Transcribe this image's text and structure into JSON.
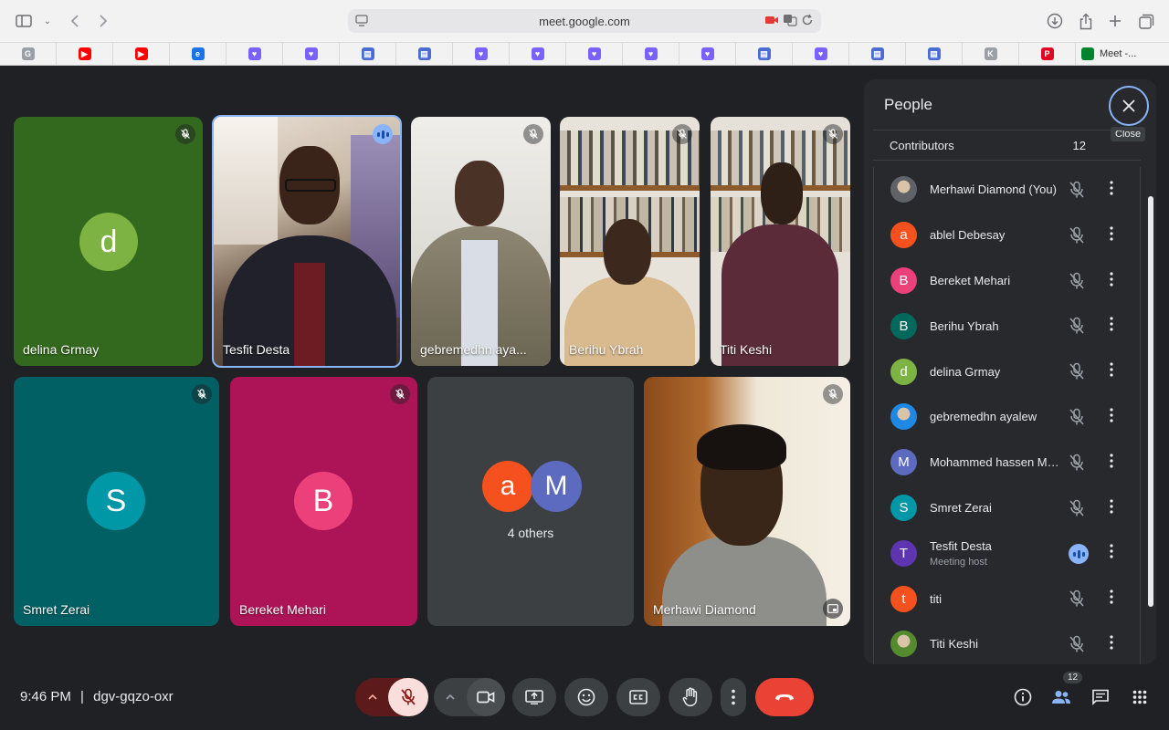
{
  "browser": {
    "url": "meet.google.com",
    "last_tab_label": "Meet -...",
    "bookmark_icons": [
      {
        "icon": "g-icon",
        "color": "#9aa0a6",
        "glyph": "G"
      },
      {
        "icon": "youtube-icon",
        "color": "#ff0000",
        "glyph": "▶"
      },
      {
        "icon": "youtube-icon",
        "color": "#ff0000",
        "glyph": "▶"
      },
      {
        "icon": "edge-icon",
        "color": "#1a73e8",
        "glyph": "e"
      },
      {
        "icon": "chat-icon",
        "color": "#7b61ff",
        "glyph": "♥"
      },
      {
        "icon": "chat-icon",
        "color": "#7b61ff",
        "glyph": "♥"
      },
      {
        "icon": "print-icon",
        "color": "#4a6cd4",
        "glyph": "▤"
      },
      {
        "icon": "print-icon",
        "color": "#4a6cd4",
        "glyph": "▤"
      },
      {
        "icon": "chat-icon",
        "color": "#7b61ff",
        "glyph": "♥"
      },
      {
        "icon": "chat-icon",
        "color": "#7b61ff",
        "glyph": "♥"
      },
      {
        "icon": "chat-icon",
        "color": "#7b61ff",
        "glyph": "♥"
      },
      {
        "icon": "chat-icon",
        "color": "#7b61ff",
        "glyph": "♥"
      },
      {
        "icon": "chat-icon",
        "color": "#7b61ff",
        "glyph": "♥"
      },
      {
        "icon": "print-icon",
        "color": "#4a6cd4",
        "glyph": "▤"
      },
      {
        "icon": "chat-icon",
        "color": "#7b61ff",
        "glyph": "♥"
      },
      {
        "icon": "print-icon",
        "color": "#4a6cd4",
        "glyph": "▤"
      },
      {
        "icon": "print-icon",
        "color": "#4a6cd4",
        "glyph": "▤"
      },
      {
        "icon": "k-icon",
        "color": "#9aa0a6",
        "glyph": "K"
      },
      {
        "icon": "pinterest-icon",
        "color": "#e60023",
        "glyph": "P"
      }
    ]
  },
  "tiles": [
    {
      "name": "delina Grmay",
      "type": "avatar",
      "letter": "d",
      "bg": "#33691e",
      "avatar": "#7cb342"
    },
    {
      "name": "Tesfit Desta",
      "type": "video",
      "speaking": true
    },
    {
      "name": "gebremedhn aya...",
      "type": "video"
    },
    {
      "name": "Berihu Ybrah",
      "type": "video"
    },
    {
      "name": "Titi Keshi",
      "type": "video"
    },
    {
      "name": "Smret Zerai",
      "type": "avatar",
      "letter": "S",
      "bg": "#006064",
      "avatar": "#0097a7"
    },
    {
      "name": "Bereket Mehari",
      "type": "avatar",
      "letter": "B",
      "bg": "#ad1457",
      "avatar": "#ec407a"
    },
    {
      "name": "4 others",
      "type": "others",
      "letters": [
        "a",
        "M"
      ]
    },
    {
      "name": "Merhawi Diamond",
      "type": "video"
    }
  ],
  "panel": {
    "title": "People",
    "close_tooltip": "Close",
    "section_label": "Contributors",
    "section_count": "12",
    "people": [
      {
        "name": "Merhawi Diamond (You)",
        "letter": "",
        "color": "#5f6368",
        "photo": true
      },
      {
        "name": "ablel Debesay",
        "letter": "a",
        "color": "#f4511e"
      },
      {
        "name": "Bereket Mehari",
        "letter": "B",
        "color": "#ec407a"
      },
      {
        "name": "Berihu Ybrah",
        "letter": "B",
        "color": "#00695c"
      },
      {
        "name": "delina Grmay",
        "letter": "d",
        "color": "#7cb342"
      },
      {
        "name": "gebremedhn ayalew",
        "letter": "",
        "color": "#1e88e5",
        "photo": true
      },
      {
        "name": "Mohammed hassen Mo...",
        "letter": "M",
        "color": "#5c6bc0"
      },
      {
        "name": "Smret Zerai",
        "letter": "S",
        "color": "#0097a7"
      },
      {
        "name": "Tesfit Desta",
        "sub": "Meeting host",
        "letter": "T",
        "color": "#5e35b1",
        "speaking": true
      },
      {
        "name": "titi",
        "letter": "t",
        "color": "#f4511e"
      },
      {
        "name": "Titi Keshi",
        "letter": "",
        "color": "#558b2f",
        "photo": true
      }
    ]
  },
  "bottom": {
    "time": "9:46 PM",
    "separator": "|",
    "meeting_code": "dgv-gqzo-oxr",
    "people_count": "12"
  }
}
